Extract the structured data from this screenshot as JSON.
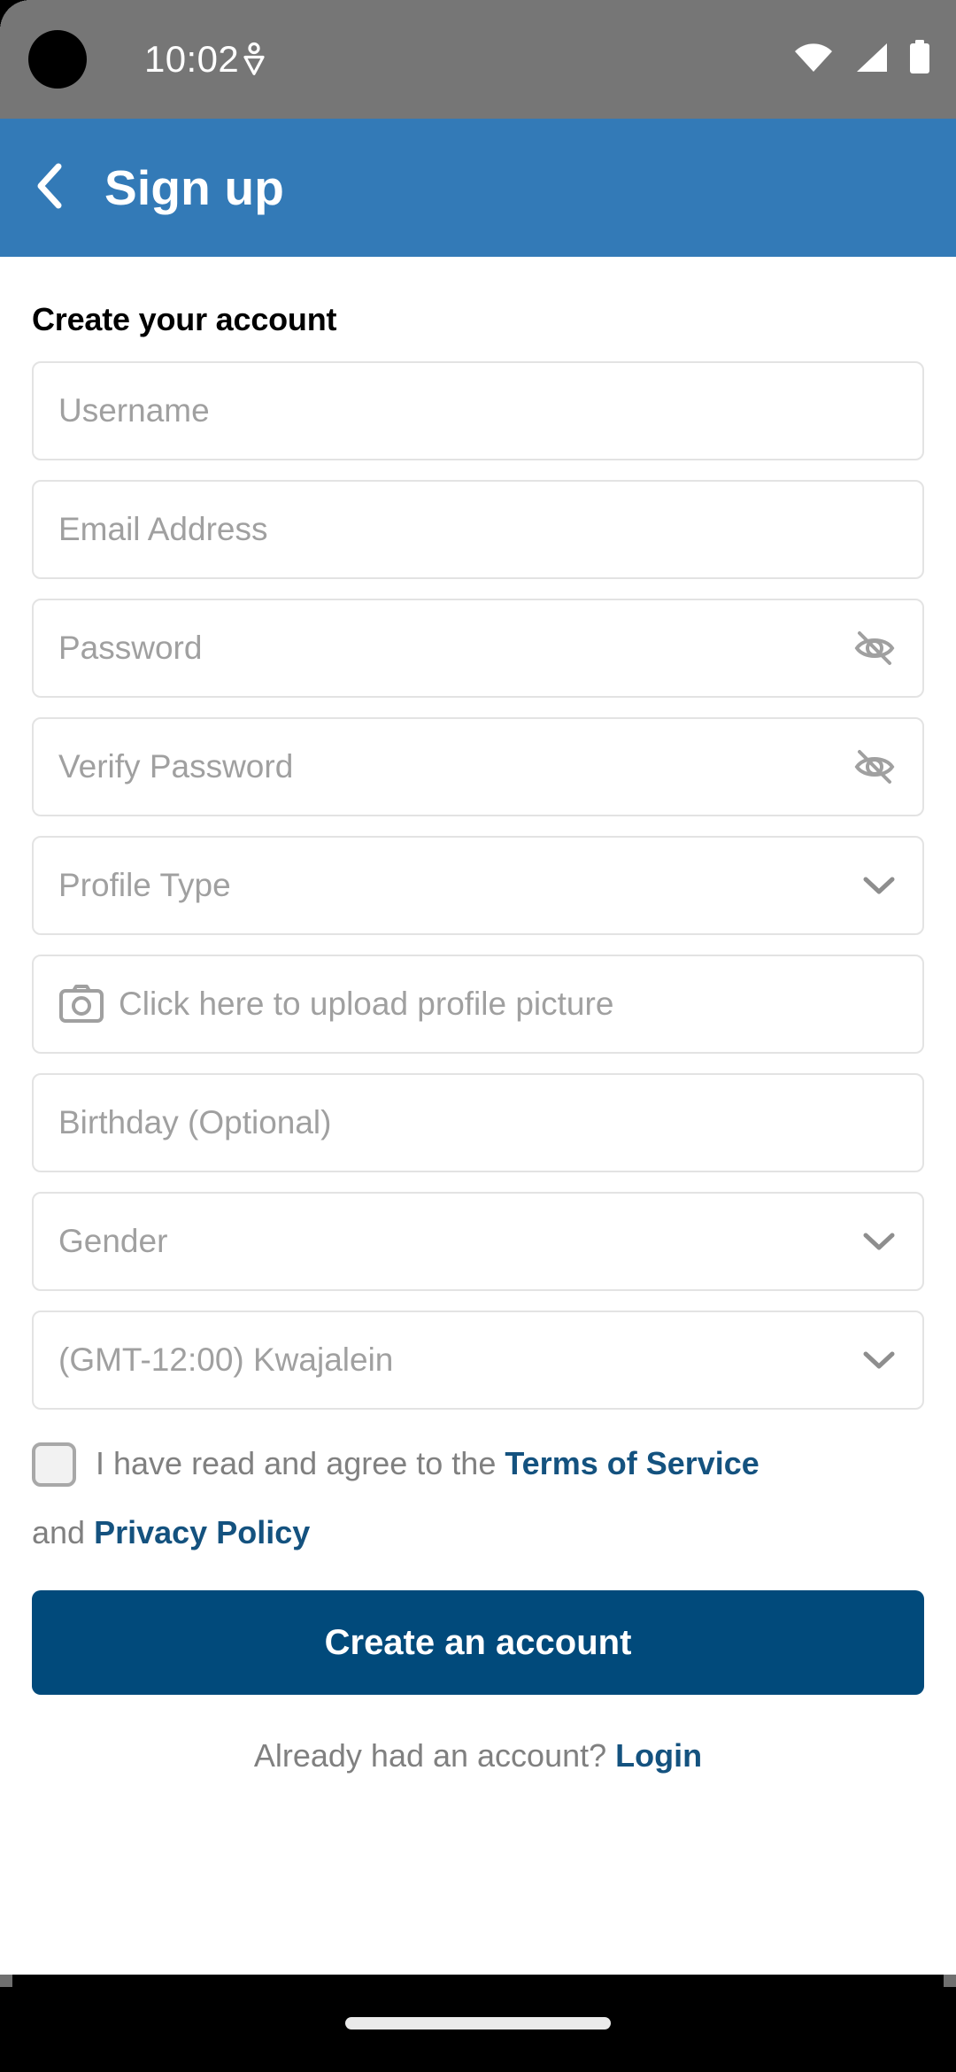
{
  "status_bar": {
    "time": "10:02",
    "left_icon": "location-sharing-icon",
    "icons": [
      "wifi-icon",
      "cellular-signal-icon",
      "battery-icon"
    ]
  },
  "app_bar": {
    "back_icon": "chevron-left-icon",
    "title": "Sign up",
    "background_color": "#337ab7"
  },
  "form": {
    "section_title": "Create your account",
    "fields": [
      {
        "name": "username",
        "placeholder": "Username",
        "trailing_icon": "",
        "leading_icon": ""
      },
      {
        "name": "email",
        "placeholder": "Email Address",
        "trailing_icon": "",
        "leading_icon": ""
      },
      {
        "name": "password",
        "placeholder": "Password",
        "trailing_icon": "eye-off-icon",
        "leading_icon": ""
      },
      {
        "name": "verify-password",
        "placeholder": "Verify Password",
        "trailing_icon": "eye-off-icon",
        "leading_icon": ""
      },
      {
        "name": "profile-type",
        "placeholder": "Profile Type",
        "trailing_icon": "chevron-down-icon",
        "leading_icon": ""
      },
      {
        "name": "profile-picture",
        "placeholder": "Click here to upload profile picture",
        "trailing_icon": "",
        "leading_icon": "camera-icon"
      },
      {
        "name": "birthday",
        "placeholder": "Birthday (Optional)",
        "trailing_icon": "",
        "leading_icon": ""
      },
      {
        "name": "gender",
        "placeholder": "Gender",
        "trailing_icon": "chevron-down-icon",
        "leading_icon": ""
      },
      {
        "name": "timezone",
        "placeholder": "(GMT-12:00) Kwajalein",
        "trailing_icon": "chevron-down-icon",
        "leading_icon": ""
      }
    ]
  },
  "terms": {
    "checked": false,
    "text_before": "I have read and agree to the ",
    "terms_link": "Terms of Service",
    "conjunction": "and ",
    "privacy_link": "Privacy Policy",
    "link_color": "#14527f"
  },
  "submit": {
    "label": "Create an account",
    "background_color": "#014a7b"
  },
  "footer": {
    "text": "Already had an account? ",
    "login_link": "Login"
  },
  "nav_bar": {
    "gesture_pill": "home-gesture-pill"
  }
}
